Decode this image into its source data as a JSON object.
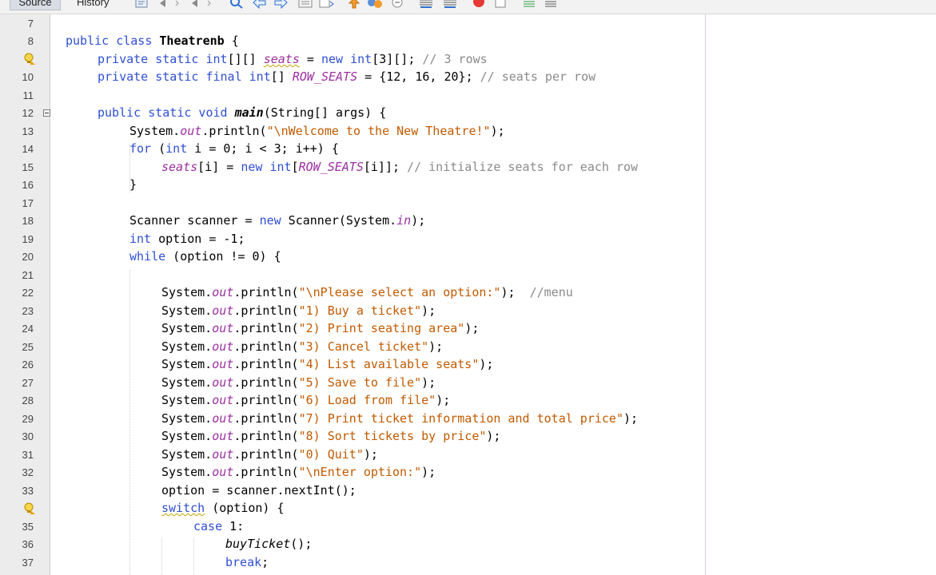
{
  "tabs": {
    "source": "Source",
    "history": "History"
  },
  "line_numbers": [
    "7",
    "8",
    "",
    "10",
    "11",
    "12",
    "13",
    "14",
    "15",
    "16",
    "17",
    "18",
    "19",
    "20",
    "21",
    "22",
    "23",
    "24",
    "25",
    "26",
    "27",
    "28",
    "29",
    "30",
    "31",
    "32",
    "33",
    "",
    "35",
    "36",
    "37"
  ],
  "code": {
    "l8": {
      "kw1": "public class ",
      "name": "Theatrenb",
      "rest": " {"
    },
    "l9": {
      "kw1": "private static int",
      "a": "[][] ",
      "fld": "seats",
      "b": " = ",
      "kw2": "new int",
      "c": "[3][]; ",
      "cmt": "// 3 rows"
    },
    "l10": {
      "kw1": "private static final int",
      "a": "[] ",
      "fld": "ROW_SEATS",
      "b": " = {12, 16, 20}; ",
      "cmt": "// seats per row"
    },
    "l12": {
      "kw1": "public static void ",
      "mth": "main",
      "rest": "(String[] args) {"
    },
    "l13": {
      "a": "System.",
      "fld": "out",
      "b": ".println(",
      "str": "\"\\nWelcome to the New Theatre!\"",
      "c": ");"
    },
    "l14": {
      "kw1": "for",
      "a": " (",
      "kw2": "int",
      "b": " i = 0; i < 3; i++) {"
    },
    "l15": {
      "fld": "seats",
      "a": "[i] = ",
      "kw": "new int",
      "b": "[",
      "fld2": "ROW_SEATS",
      "c": "[i]]; ",
      "cmt": "// initialize seats for each row"
    },
    "l16": {
      "a": "}"
    },
    "l18": {
      "a": "Scanner scanner = ",
      "kw": "new",
      "b": " Scanner(System.",
      "fld": "in",
      "c": ");"
    },
    "l19": {
      "kw": "int",
      "a": " option = -1;"
    },
    "l20": {
      "kw": "while",
      "a": " (option != 0) {"
    },
    "l22": {
      "a": "System.",
      "fld": "out",
      "b": ".println(",
      "str": "\"\\nPlease select an option:\"",
      "c": ");  ",
      "cmt": "//menu"
    },
    "l23": {
      "str": "\"1) Buy a ticket\""
    },
    "l24": {
      "str": "\"2) Print seating area\""
    },
    "l25": {
      "str": "\"3) Cancel ticket\""
    },
    "l26": {
      "str": "\"4) List available seats\""
    },
    "l27": {
      "str": "\"5) Save to file\""
    },
    "l28": {
      "str": "\"6) Load from file\""
    },
    "l29": {
      "str": "\"7) Print ticket information and total price\""
    },
    "l30": {
      "str": "\"8) Sort tickets by price\""
    },
    "l31": {
      "str": "\"0) Quit\""
    },
    "l32": {
      "str": "\"\\nEnter option:\""
    },
    "l33": {
      "a": "option = scanner.nextInt();"
    },
    "l34": {
      "kw": "switch",
      "a": " (option) {"
    },
    "l35": {
      "kw": "case",
      "a": " 1:"
    },
    "l36": {
      "mth": "buyTicket",
      "a": "();"
    },
    "l37": {
      "kw": "break",
      "a": ";"
    }
  },
  "println_parts": {
    "sys": "System.",
    "out": "out",
    "call": ".println(",
    "end": ");"
  },
  "icons": [
    "history-icon",
    "back-icon",
    "forward-icon",
    "search-icon",
    "prev-icon",
    "next-icon",
    "toggle-icon",
    "bookmark-icon",
    "shift-left-icon",
    "shift-right-icon",
    "record-macro-icon",
    "stop-macro-icon",
    "comment-icon",
    "uncomment-icon",
    "warning-hint-icon",
    "fold-collapse-icon"
  ],
  "colors": {
    "keyword": "#2f4fd1",
    "string": "#c15a00",
    "field": "#9b2fa0",
    "comment": "#8a8a8a"
  }
}
